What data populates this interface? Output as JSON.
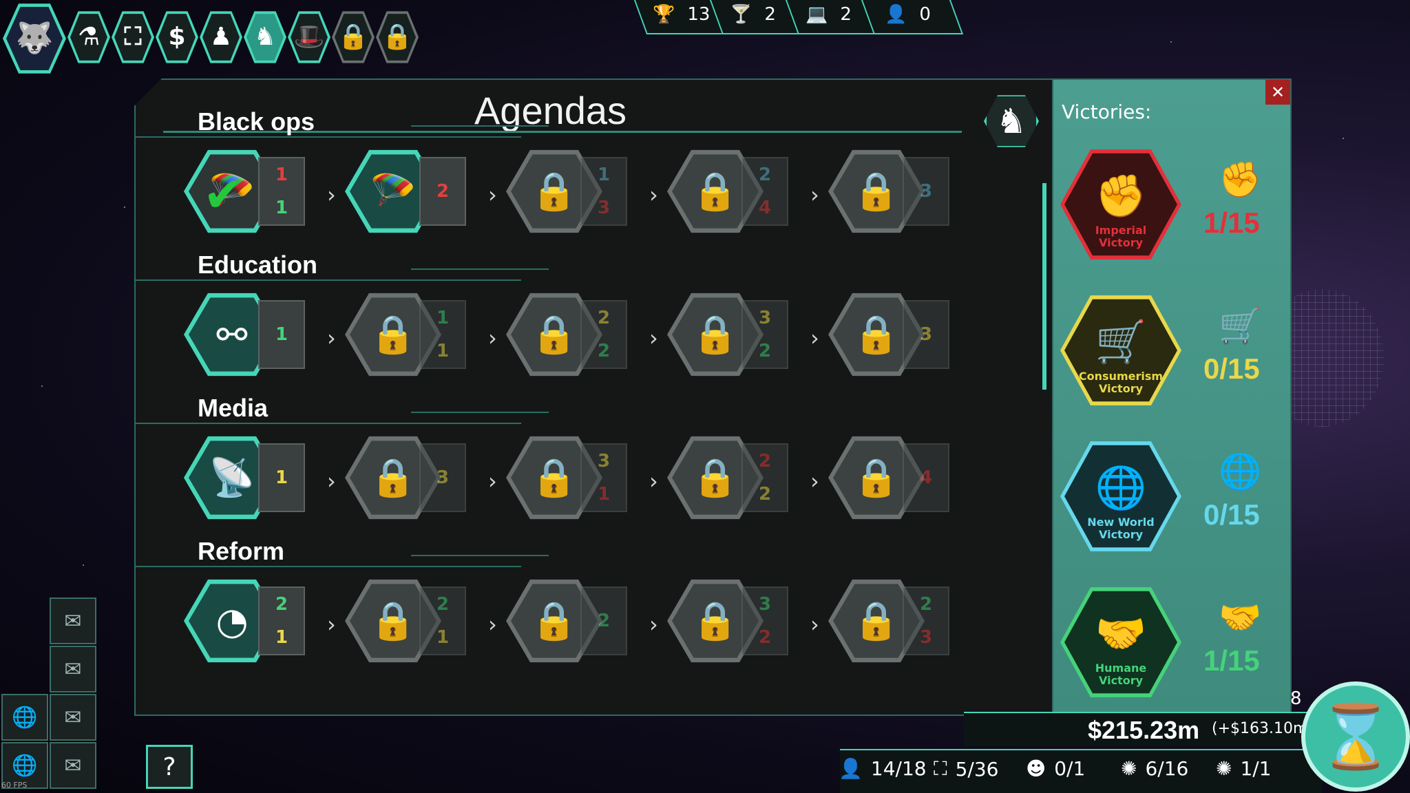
{
  "nav": {
    "items": [
      {
        "icon": "wolf-icon"
      },
      {
        "icon": "flask-icon",
        "glyph": "⚗"
      },
      {
        "icon": "network-icon",
        "glyph": "⛶"
      },
      {
        "icon": "dollar-icon",
        "glyph": "$"
      },
      {
        "icon": "population-icon",
        "glyph": "♟"
      },
      {
        "icon": "agenda-knight-icon",
        "glyph": "♞"
      },
      {
        "icon": "spy-hat-icon",
        "glyph": "🎩"
      },
      {
        "icon": "lock-icon",
        "glyph": "🔒"
      },
      {
        "icon": "lock-icon",
        "glyph": "🔒"
      }
    ]
  },
  "resources": {
    "trophy": "13",
    "cocktail": "2",
    "laptop": "2",
    "agent": "0"
  },
  "panel": {
    "title": "Agendas",
    "help_glyph": "♞"
  },
  "sections": [
    {
      "title": "Black ops",
      "nodes": [
        {
          "state": "done",
          "glyph": "🪂",
          "req": [
            {
              "icon": "fist",
              "val": "1",
              "color": "#e04040"
            },
            {
              "icon": "handshake",
              "val": "1",
              "color": "#46d27a"
            }
          ]
        },
        {
          "state": "open",
          "glyph": "🪂",
          "req": [
            {
              "icon": "fist",
              "val": "2",
              "color": "#e04040"
            }
          ]
        },
        {
          "state": "locked",
          "glyph": "🔒",
          "req": [
            {
              "icon": "globe-person",
              "val": "1",
              "color": "#5fb8d0"
            },
            {
              "icon": "fist",
              "val": "3",
              "color": "#e04040"
            }
          ]
        },
        {
          "state": "locked",
          "glyph": "🔒",
          "req": [
            {
              "icon": "globe-person",
              "val": "2",
              "color": "#5fb8d0"
            },
            {
              "icon": "fist",
              "val": "4",
              "color": "#e04040"
            }
          ]
        },
        {
          "state": "locked",
          "glyph": "🔒",
          "req": [
            {
              "icon": "globe-person",
              "val": "3",
              "color": "#5fb8d0"
            }
          ]
        }
      ]
    },
    {
      "title": "Education",
      "nodes": [
        {
          "state": "open",
          "glyph": "⚯",
          "req": [
            {
              "icon": "handshake",
              "val": "1",
              "color": "#46d27a"
            }
          ]
        },
        {
          "state": "locked",
          "glyph": "🔒",
          "req": [
            {
              "icon": "handshake",
              "val": "1",
              "color": "#46d27a"
            },
            {
              "icon": "puppet",
              "val": "1",
              "color": "#e8d84a"
            }
          ]
        },
        {
          "state": "locked",
          "glyph": "🔒",
          "req": [
            {
              "icon": "puppet",
              "val": "2",
              "color": "#e8d84a"
            },
            {
              "icon": "handshake",
              "val": "2",
              "color": "#46d27a"
            }
          ]
        },
        {
          "state": "locked",
          "glyph": "🔒",
          "req": [
            {
              "icon": "puppet",
              "val": "3",
              "color": "#e8d84a"
            },
            {
              "icon": "handshake",
              "val": "2",
              "color": "#46d27a"
            }
          ]
        },
        {
          "state": "locked",
          "glyph": "🔒",
          "req": [
            {
              "icon": "puppet",
              "val": "3",
              "color": "#e8d84a"
            }
          ]
        }
      ]
    },
    {
      "title": "Media",
      "nodes": [
        {
          "state": "open",
          "glyph": "📡",
          "req": [
            {
              "icon": "puppet",
              "val": "1",
              "color": "#e8d84a"
            }
          ]
        },
        {
          "state": "locked",
          "glyph": "🔒",
          "req": [
            {
              "icon": "puppet",
              "val": "3",
              "color": "#e8d84a"
            }
          ]
        },
        {
          "state": "locked",
          "glyph": "🔒",
          "req": [
            {
              "icon": "puppet",
              "val": "3",
              "color": "#e8d84a"
            },
            {
              "icon": "fist",
              "val": "1",
              "color": "#e04040"
            }
          ]
        },
        {
          "state": "locked",
          "glyph": "🔒",
          "req": [
            {
              "icon": "fist",
              "val": "2",
              "color": "#e04040"
            },
            {
              "icon": "puppet",
              "val": "2",
              "color": "#e8d84a"
            }
          ]
        },
        {
          "state": "locked",
          "glyph": "🔒",
          "req": [
            {
              "icon": "fist",
              "val": "4",
              "color": "#e04040"
            }
          ]
        }
      ]
    },
    {
      "title": "Reform",
      "nodes": [
        {
          "state": "open",
          "glyph": "◔",
          "req": [
            {
              "icon": "handshake",
              "val": "2",
              "color": "#46d27a"
            },
            {
              "icon": "puppet",
              "val": "1",
              "color": "#e8d84a"
            }
          ]
        },
        {
          "state": "locked",
          "glyph": "🔒",
          "req": [
            {
              "icon": "handshake",
              "val": "2",
              "color": "#46d27a"
            },
            {
              "icon": "puppet",
              "val": "1",
              "color": "#e8d84a"
            }
          ]
        },
        {
          "state": "locked",
          "glyph": "🔒",
          "req": [
            {
              "icon": "handshake",
              "val": "2",
              "color": "#46d27a"
            }
          ]
        },
        {
          "state": "locked",
          "glyph": "🔒",
          "req": [
            {
              "icon": "handshake",
              "val": "3",
              "color": "#46d27a"
            },
            {
              "icon": "fist",
              "val": "2",
              "color": "#e04040"
            }
          ]
        },
        {
          "state": "locked",
          "glyph": "🔒",
          "req": [
            {
              "icon": "handshake",
              "val": "2",
              "color": "#46d27a"
            },
            {
              "icon": "fist",
              "val": "3",
              "color": "#e04040"
            }
          ]
        }
      ]
    }
  ],
  "victories": {
    "title": "Victories:",
    "close_glyph": "✕",
    "items": [
      {
        "label_1": "Imperial",
        "label_2": "Victory",
        "score": "1/15",
        "color": "#e3303a",
        "bg": "#3a1212",
        "glyph": "✊",
        "icon": "fist-laurel-icon"
      },
      {
        "label_1": "Consumerism",
        "label_2": "Victory",
        "score": "0/15",
        "color": "#e8d84a",
        "bg": "#2a2a10",
        "glyph": "🛒",
        "icon": "puppet-cart-icon"
      },
      {
        "label_1": "New World",
        "label_2": "Victory",
        "score": "0/15",
        "color": "#66d8ec",
        "bg": "#123034",
        "glyph": "🌐",
        "icon": "globe-people-icon"
      },
      {
        "label_1": "Humane",
        "label_2": "Victory",
        "score": "1/15",
        "color": "#46d27a",
        "bg": "#0f3320",
        "glyph": "🤝",
        "icon": "globe-handshake-icon"
      }
    ]
  },
  "footer": {
    "money": "$215.23m",
    "money_delta": "(+$163.10m)",
    "side_count": "8",
    "stats": [
      {
        "icon": "person-icon",
        "glyph": "👤",
        "val": "14/18"
      },
      {
        "icon": "network-icon",
        "glyph": "⛶",
        "val": "5/36"
      },
      {
        "icon": "mind-icon",
        "glyph": "☻",
        "val": "0/1"
      },
      {
        "icon": "brain-icon",
        "glyph": "✺",
        "val": "6/16"
      },
      {
        "icon": "brain-plus-icon",
        "glyph": "✺",
        "val": "1/1"
      }
    ],
    "fps": "60 FPS"
  }
}
